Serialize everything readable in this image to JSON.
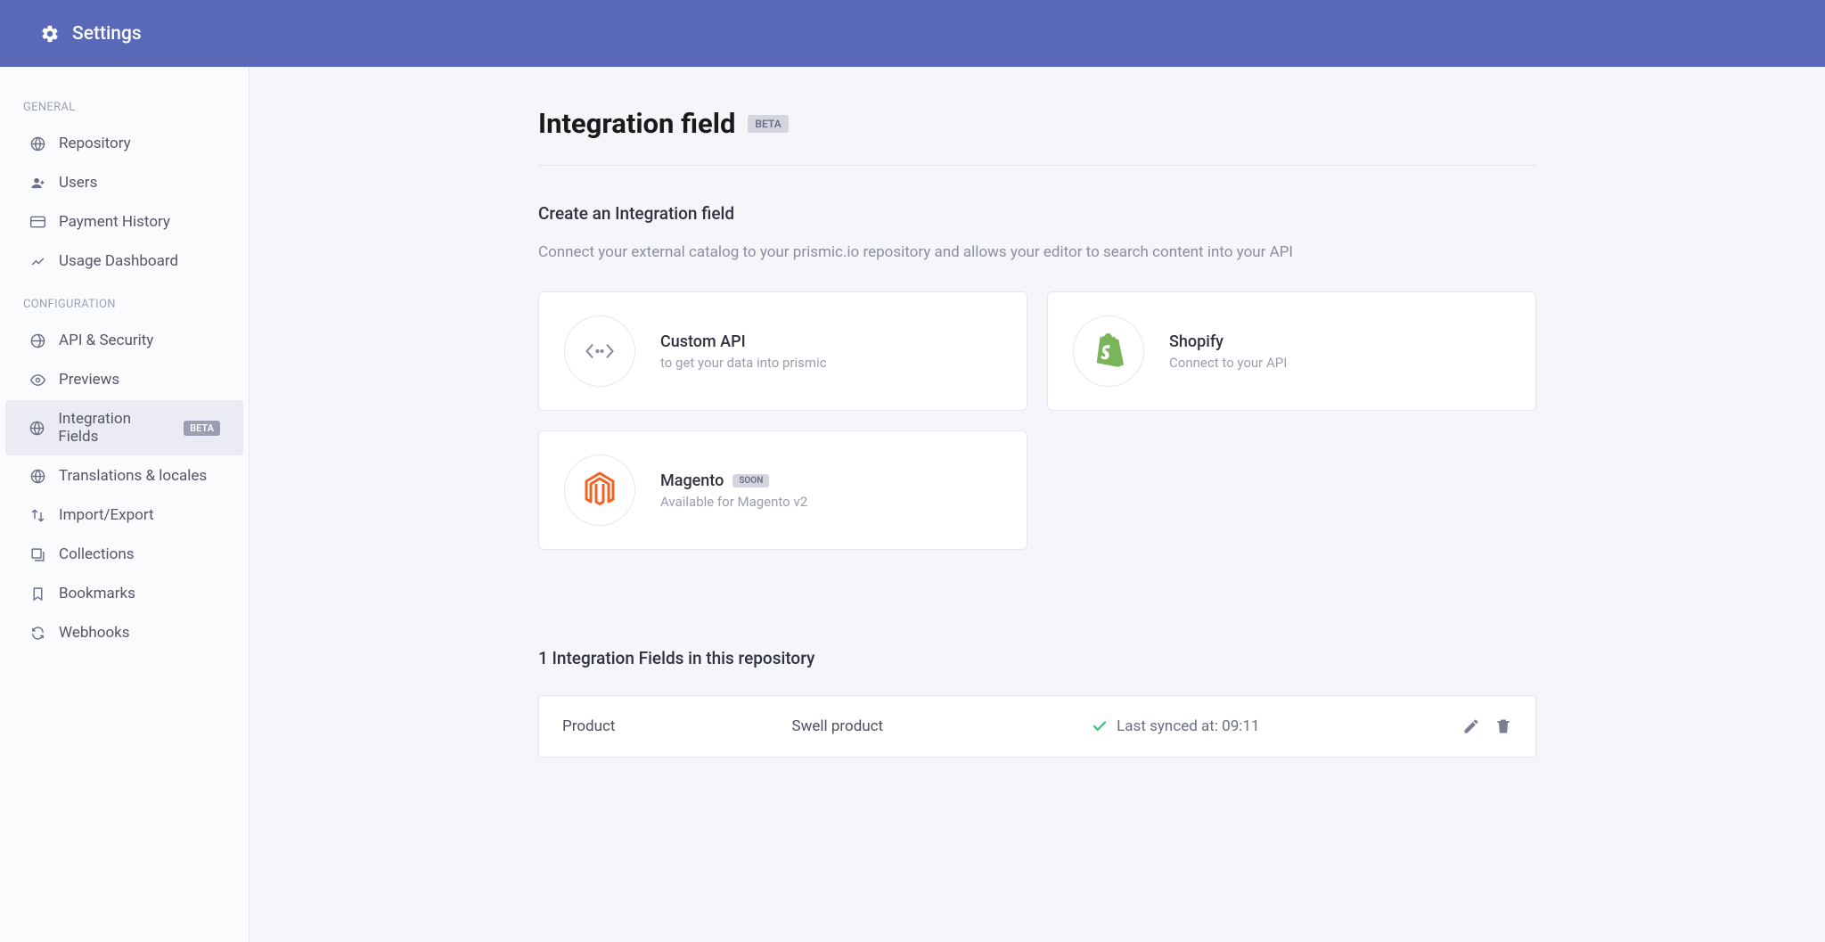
{
  "header": {
    "title": "Settings"
  },
  "sidebar": {
    "section_general": "GENERAL",
    "section_config": "CONFIGURATION",
    "general": [
      {
        "label": "Repository",
        "icon": "globe"
      },
      {
        "label": "Users",
        "icon": "user"
      },
      {
        "label": "Payment History",
        "icon": "card"
      },
      {
        "label": "Usage Dashboard",
        "icon": "chart"
      }
    ],
    "config": [
      {
        "label": "API & Security",
        "icon": "globe"
      },
      {
        "label": "Previews",
        "icon": "eye"
      },
      {
        "label": "Integration Fields",
        "icon": "web",
        "badge": "BETA",
        "active": true
      },
      {
        "label": "Translations & locales",
        "icon": "web"
      },
      {
        "label": "Import/Export",
        "icon": "swap"
      },
      {
        "label": "Collections",
        "icon": "stack"
      },
      {
        "label": "Bookmarks",
        "icon": "bookmark"
      },
      {
        "label": "Webhooks",
        "icon": "refresh"
      }
    ]
  },
  "main": {
    "title": "Integration field",
    "badge": "BETA",
    "create_heading": "Create an Integration field",
    "create_desc": "Connect your external catalog to your prismic.io repository and allows your editor to search content into your API",
    "cards": [
      {
        "title": "Custom API",
        "desc": "to get your data into prismic",
        "icon": "code"
      },
      {
        "title": "Shopify",
        "desc": "Connect to your API",
        "icon": "shopify"
      },
      {
        "title": "Magento",
        "desc": "Available for Magento v2",
        "icon": "magento",
        "tag": "SOON"
      }
    ],
    "list_heading": "1 Integration Fields in this repository",
    "row": {
      "name": "Product",
      "type": "Swell product",
      "sync": "Last synced at: 09:11"
    }
  }
}
